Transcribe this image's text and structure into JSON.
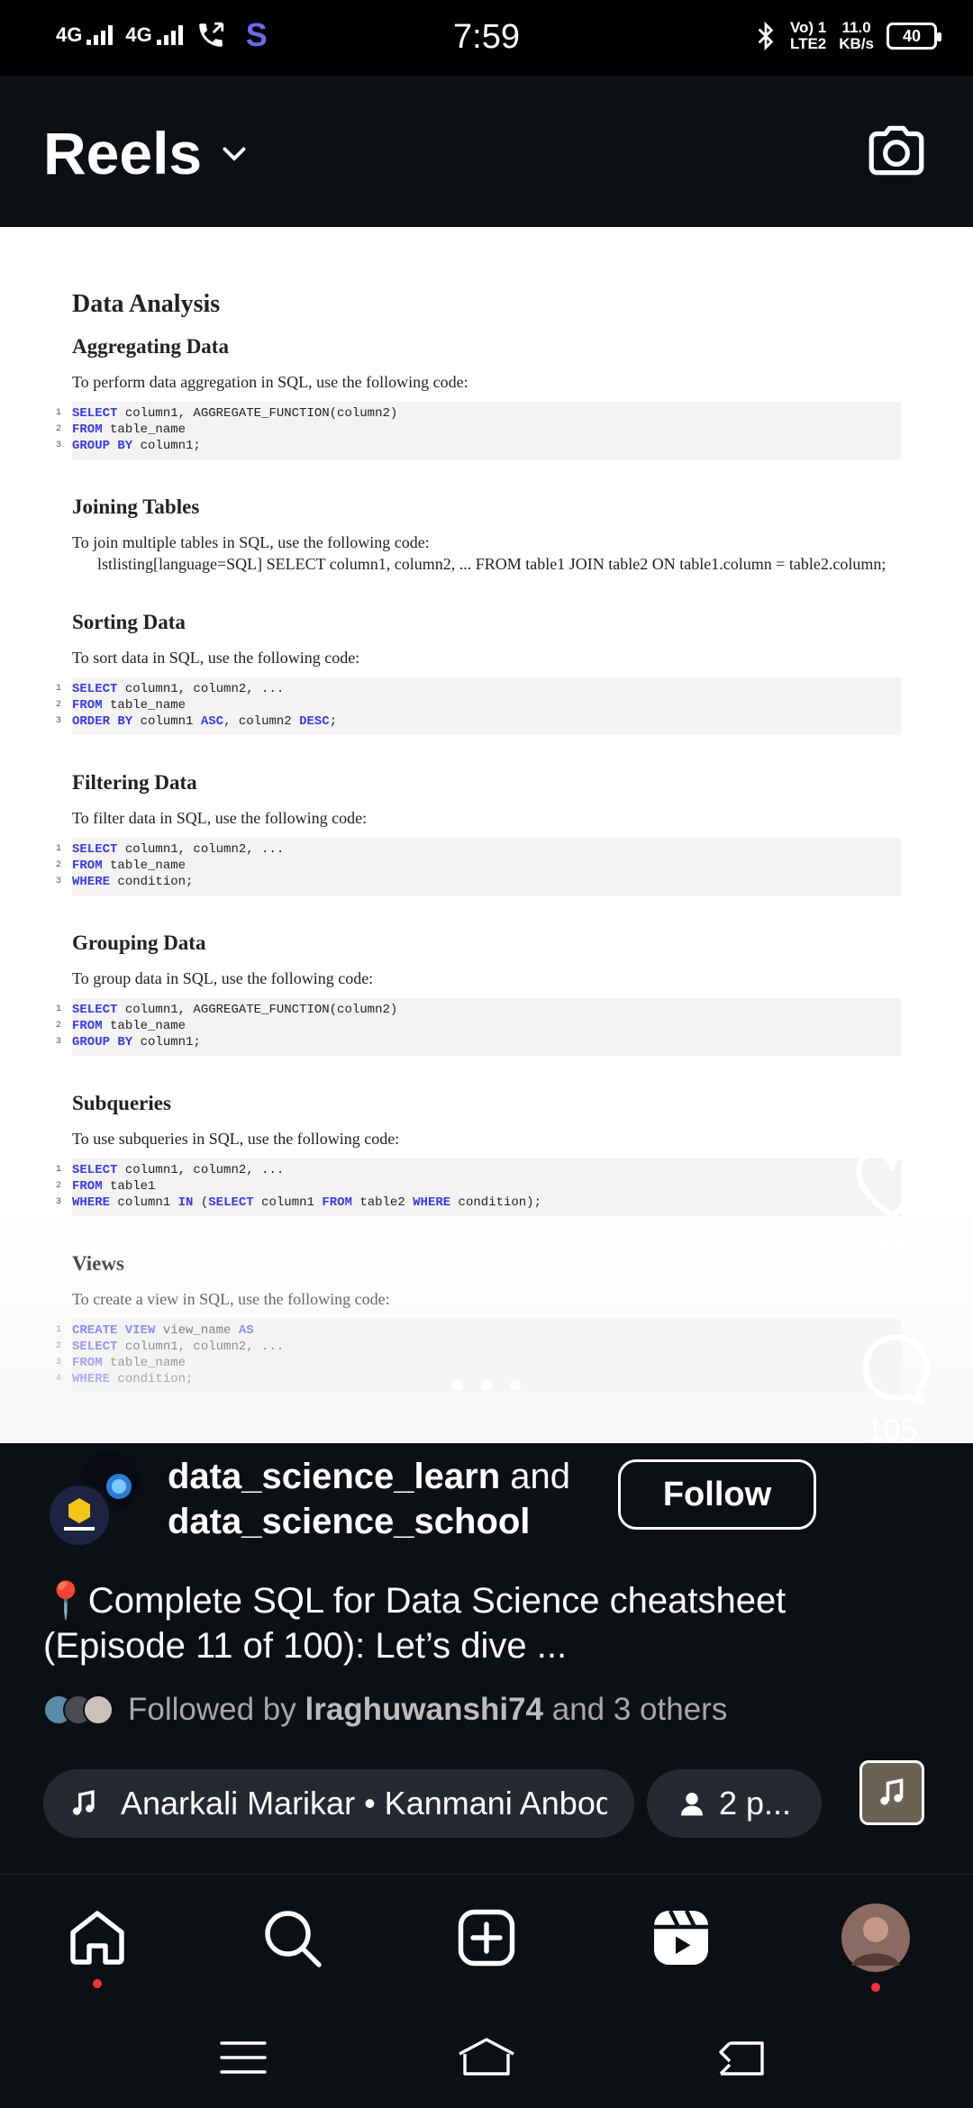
{
  "status_bar": {
    "net1": "4G",
    "net2": "4G",
    "s_icon": "S",
    "time": "7:59",
    "volte": "Vo) 1",
    "lte": "LTE2",
    "speed_value": "11.0",
    "speed_unit": "KB/s",
    "battery": "40"
  },
  "header": {
    "title": "Reels"
  },
  "document": {
    "title": "Data Analysis",
    "sections": [
      {
        "title": "Aggregating Data",
        "desc": "To perform data aggregation in SQL, use the following code:",
        "code": [
          [
            [
              "kw",
              "SELECT"
            ],
            [
              "plain",
              " column1, AGGREGATE_FUNCTION(column2)"
            ]
          ],
          [
            [
              "kw",
              "FROM"
            ],
            [
              "plain",
              " table_name"
            ]
          ],
          [
            [
              "kw",
              "GROUP BY"
            ],
            [
              "plain",
              " column1;"
            ]
          ]
        ]
      },
      {
        "title": "Joining Tables",
        "desc": "To join multiple tables in SQL, use the following code:",
        "join_text": "lstlisting[language=SQL] SELECT column1, column2, ... FROM table1 JOIN table2 ON table1.column = table2.column;"
      },
      {
        "title": "Sorting Data",
        "desc": "To sort data in SQL, use the following code:",
        "code": [
          [
            [
              "kw",
              "SELECT"
            ],
            [
              "plain",
              " column1, column2, ..."
            ]
          ],
          [
            [
              "kw",
              "FROM"
            ],
            [
              "plain",
              " table_name"
            ]
          ],
          [
            [
              "kw",
              "ORDER BY"
            ],
            [
              "plain",
              " column1 "
            ],
            [
              "kw",
              "ASC"
            ],
            [
              "plain",
              ", column2 "
            ],
            [
              "kw",
              "DESC"
            ],
            [
              "plain",
              ";"
            ]
          ]
        ]
      },
      {
        "title": "Filtering Data",
        "desc": "To filter data in SQL, use the following code:",
        "code": [
          [
            [
              "kw",
              "SELECT"
            ],
            [
              "plain",
              " column1, column2, ..."
            ]
          ],
          [
            [
              "kw",
              "FROM"
            ],
            [
              "plain",
              " table_name"
            ]
          ],
          [
            [
              "kw",
              "WHERE"
            ],
            [
              "plain",
              " condition;"
            ]
          ]
        ]
      },
      {
        "title": "Grouping Data",
        "desc": "To group data in SQL, use the following code:",
        "code": [
          [
            [
              "kw",
              "SELECT"
            ],
            [
              "plain",
              " column1, AGGREGATE_FUNCTION(column2)"
            ]
          ],
          [
            [
              "kw",
              "FROM"
            ],
            [
              "plain",
              " table_name"
            ]
          ],
          [
            [
              "kw",
              "GROUP BY"
            ],
            [
              "plain",
              " column1;"
            ]
          ]
        ]
      },
      {
        "title": "Subqueries",
        "desc": "To use subqueries in SQL, use the following code:",
        "code": [
          [
            [
              "kw",
              "SELECT"
            ],
            [
              "plain",
              " column1, column2, ..."
            ]
          ],
          [
            [
              "kw",
              "FROM"
            ],
            [
              "plain",
              " table1"
            ]
          ],
          [
            [
              "kw",
              "WHERE"
            ],
            [
              "plain",
              " column1 "
            ],
            [
              "kw",
              "IN"
            ],
            [
              "plain",
              " ("
            ],
            [
              "kw",
              "SELECT"
            ],
            [
              "plain",
              " column1 "
            ],
            [
              "kw",
              "FROM"
            ],
            [
              "plain",
              " table2 "
            ],
            [
              "kw",
              "WHERE"
            ],
            [
              "plain",
              " condition);"
            ]
          ]
        ]
      },
      {
        "title": "Views",
        "desc": "To create a view in SQL, use the following code:",
        "code": [
          [
            [
              "kw",
              "CREATE VIEW"
            ],
            [
              "plain",
              " view_name "
            ],
            [
              "kw",
              "AS"
            ]
          ],
          [
            [
              "kw",
              "SELECT"
            ],
            [
              "plain",
              " column1, column2, ..."
            ]
          ],
          [
            [
              "kw",
              "FROM"
            ],
            [
              "plain",
              " table_name"
            ]
          ],
          [
            [
              "kw",
              "WHERE"
            ],
            [
              "plain",
              " condition;"
            ]
          ]
        ]
      }
    ]
  },
  "actions": {
    "likes_label": "Likes",
    "comments_count": "105"
  },
  "post": {
    "author1": "data_science_learn",
    "and": " and",
    "author2": "data_science_school",
    "follow_label": "Follow",
    "caption": "📍Complete SQL for Data Science cheatsheet (Episode 11 of 100): Let’s dive ...",
    "followed_prefix": "Followed by ",
    "followed_user": "lraghuwanshi74",
    "followed_suffix": " and 3 others",
    "audio": "Anarkali Marikar • Kanmani Anbodu",
    "people": "2 p..."
  },
  "colors": {
    "background": "#0c1014",
    "keyword_blue": "#3b3bdc",
    "notification_red": "#ff3040"
  }
}
